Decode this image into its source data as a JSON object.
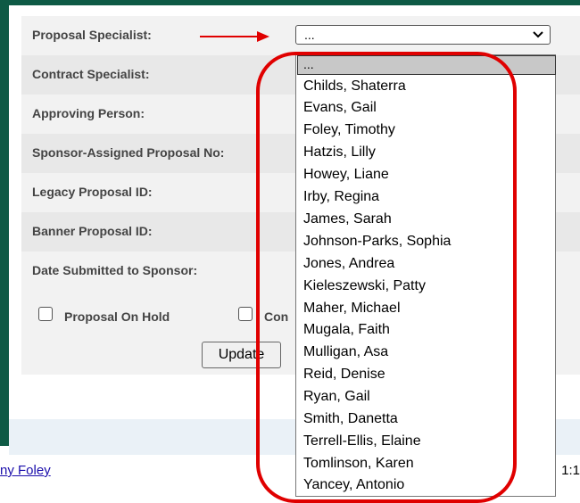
{
  "form": {
    "proposal_specialist_label": "Proposal Specialist:",
    "contract_specialist_label": "Contract Specialist:",
    "approving_person_label": "Approving Person:",
    "sponsor_assigned_label": "Sponsor-Assigned Proposal No:",
    "legacy_id_label": "Legacy Proposal ID:",
    "banner_id_label": "Banner Proposal ID:",
    "date_submitted_label": "Date Submitted to Sponsor:",
    "select_value": "...",
    "checkbox_hold_label": "Proposal On Hold",
    "checkbox_second_label": "Con",
    "update_label": "Update"
  },
  "dropdown": {
    "options": [
      "...",
      "Childs, Shaterra",
      "Evans, Gail",
      "Foley, Timothy",
      "Hatzis, Lilly",
      "Howey, Liane",
      "Irby, Regina",
      "James, Sarah",
      "Johnson-Parks, Sophia",
      "Jones, Andrea",
      "Kieleszewski, Patty",
      "Maher, Michael",
      "Mugala, Faith",
      "Mulligan, Asa",
      "Reid, Denise",
      "Ryan, Gail",
      "Smith, Danetta",
      "Terrell-Ellis, Elaine",
      "Tomlinson, Karen",
      "Yancey, Antonio"
    ]
  },
  "footer": {
    "link_text": "ny Foley",
    "right_text": "1:1"
  },
  "colors": {
    "frame": "#0e5a45",
    "annotation": "#e00000"
  }
}
